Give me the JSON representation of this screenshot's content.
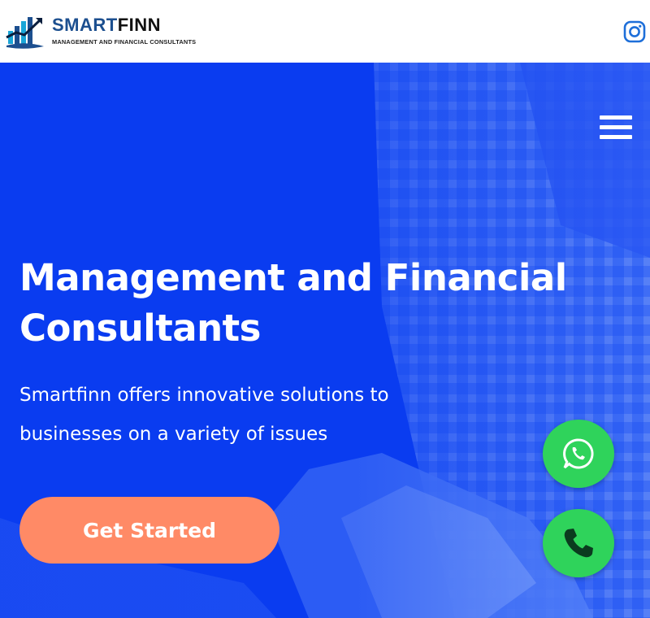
{
  "header": {
    "brand_part1": "SMART",
    "brand_part2": "FINN",
    "tagline": "MANAGEMENT AND FINANCIAL CONSULTANTS",
    "social_icon": "instagram-icon"
  },
  "hero": {
    "title": "Management and Financial Consultants",
    "subtitle": "Smartfinn offers innovative solutions to businesses on a variety of issues",
    "cta_label": "Get Started",
    "menu_icon": "hamburger-menu-icon"
  },
  "floating": {
    "whatsapp_icon": "whatsapp-icon",
    "phone_icon": "phone-icon"
  },
  "colors": {
    "hero_blue": "#0a3cf0",
    "cta_orange": "#ff8a66",
    "fab_green": "#2fd35b",
    "brand_blue": "#1c4f8f",
    "instagram_blue": "#1e6fd9"
  }
}
